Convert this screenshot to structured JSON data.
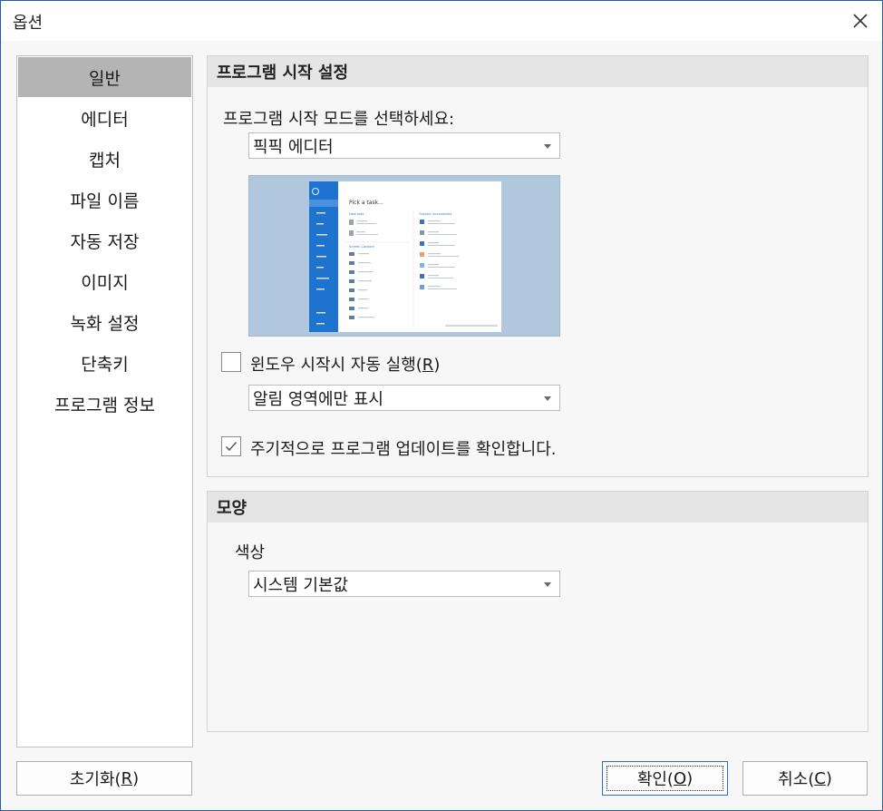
{
  "window": {
    "title": "옵션"
  },
  "sidebar": {
    "items": [
      {
        "label": "일반",
        "selected": true
      },
      {
        "label": "에디터"
      },
      {
        "label": "캡처"
      },
      {
        "label": "파일 이름"
      },
      {
        "label": "자동 저장"
      },
      {
        "label": "이미지"
      },
      {
        "label": "녹화 설정"
      },
      {
        "label": "단축키"
      },
      {
        "label": "프로그램 정보"
      }
    ]
  },
  "startup": {
    "header": "프로그램 시작 설정",
    "mode_prompt": "프로그램 시작 모드를 선택하세요:",
    "mode_value": "픽픽 에디터",
    "preview": {
      "heading": "Pick a task...",
      "left_group_title": "New task",
      "left_group2_title": "Screen Capture",
      "right_group_title": "Graphic Accessories"
    },
    "autorun": {
      "label_prefix": "윈도우 시작시 자동 실행(",
      "mnemonic": "R",
      "label_suffix": ")",
      "checked": false
    },
    "tray_value": "알림 영역에만 표시",
    "update_check": {
      "label": "주기적으로 프로그램 업데이트를 확인합니다.",
      "checked": true
    }
  },
  "appearance": {
    "header": "모양",
    "color_label": "색상",
    "color_value": "시스템 기본값"
  },
  "buttons": {
    "reset": {
      "prefix": "초기화(",
      "mnemonic": "R",
      "suffix": ")"
    },
    "ok": {
      "prefix": "확인(",
      "mnemonic": "O",
      "suffix": ")"
    },
    "cancel": {
      "prefix": "취소(",
      "mnemonic": "C",
      "suffix": ")"
    }
  },
  "icons": {
    "close": "close-icon",
    "dropdown": "chevron-down-icon",
    "check": "check-icon"
  },
  "colors": {
    "accent_border": "#1f5fb0",
    "selected_item": "#b4b4b4",
    "preview_bg": "#b0c7de",
    "preview_sidebar": "#1f73d0"
  }
}
